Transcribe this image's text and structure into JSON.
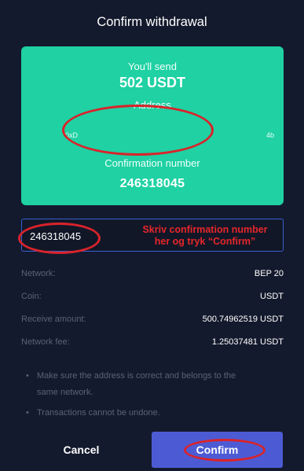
{
  "dialog": {
    "title": "Confirm withdrawal",
    "send_label": "You'll send",
    "send_amount": "502 USDT",
    "address_label": "Address",
    "address_start": "0xD",
    "address_end": "4b",
    "confirmation_label": "Confirmation number",
    "confirmation_number": "246318045"
  },
  "input": {
    "value": "246318045"
  },
  "annotation": {
    "line1": "Skriv confirmation number",
    "line2": "her og tryk “Confirm”"
  },
  "details": [
    {
      "label": "Network:",
      "value": "BEP 20"
    },
    {
      "label": "Coin:",
      "value": "USDT"
    },
    {
      "label": "Receive amount:",
      "value": "500.74962519 USDT"
    },
    {
      "label": "Network fee:",
      "value": "1.25037481 USDT"
    }
  ],
  "notes": [
    {
      "bullet": "•",
      "line1": "Make sure the address is correct and belongs to the",
      "line2": "same network."
    },
    {
      "bullet": "•",
      "line1": "Transactions cannot be undone.",
      "line2": ""
    }
  ],
  "buttons": {
    "cancel": "Cancel",
    "confirm": "Confirm"
  },
  "colors": {
    "background": "#141a2d",
    "card": "#1fd1a3",
    "annotation_red": "#d9232b",
    "confirm_button": "#4c5bd4",
    "muted_text": "#5b6275"
  }
}
